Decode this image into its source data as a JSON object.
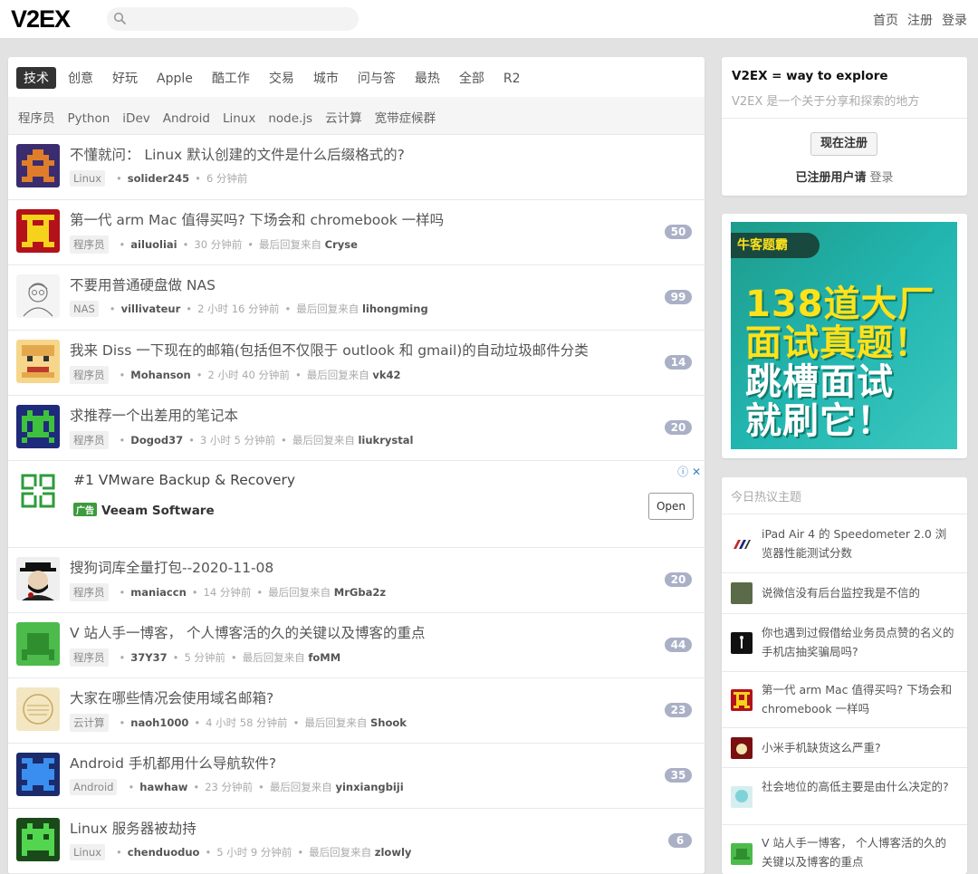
{
  "header": {
    "logo": "V2EX",
    "nav": [
      "首页",
      "注册",
      "登录"
    ]
  },
  "tabs": [
    "技术",
    "创意",
    "好玩",
    "Apple",
    "酷工作",
    "交易",
    "城市",
    "问与答",
    "最热",
    "全部",
    "R2"
  ],
  "subtabs": [
    "程序员",
    "Python",
    "iDev",
    "Android",
    "Linux",
    "node.js",
    "云计算",
    "宽带症候群"
  ],
  "topics": [
    {
      "title": "不懂就问： Linux 默认创建的文件是什么后缀格式的?",
      "node": "Linux",
      "user": "solider245",
      "time": "6 分钟前",
      "reply_label": "",
      "last_user": "",
      "count": ""
    },
    {
      "title": "第一代 arm Mac 值得买吗? 下场会和 chromebook 一样吗",
      "node": "程序员",
      "user": "ailuoliai",
      "time": "30 分钟前",
      "reply_label": "最后回复来自",
      "last_user": "Cryse",
      "count": "50"
    },
    {
      "title": "不要用普通硬盘做 NAS",
      "node": "NAS",
      "user": "villivateur",
      "time": "2 小时 16 分钟前",
      "reply_label": "最后回复来自",
      "last_user": "lihongming",
      "count": "99"
    },
    {
      "title": "我来 Diss 一下现在的邮箱(包括但不仅限于 outlook 和 gmail)的自动垃圾邮件分类",
      "node": "程序员",
      "user": "Mohanson",
      "time": "2 小时 40 分钟前",
      "reply_label": "最后回复来自",
      "last_user": "vk42",
      "count": "14"
    },
    {
      "title": "求推荐一个出差用的笔记本",
      "node": "程序员",
      "user": "Dogod37",
      "time": "3 小时 5 分钟前",
      "reply_label": "最后回复来自",
      "last_user": "liukrystal",
      "count": "20"
    },
    {
      "title": "搜狗词库全量打包--2020-11-08",
      "node": "程序员",
      "user": "maniaccn",
      "time": "14 分钟前",
      "reply_label": "最后回复来自",
      "last_user": "MrGba2z",
      "count": "20"
    },
    {
      "title": "V 站人手一博客， 个人博客活的久的关键以及博客的重点",
      "node": "程序员",
      "user": "37Y37",
      "time": "5 分钟前",
      "reply_label": "最后回复来自",
      "last_user": "foMM",
      "count": "44"
    },
    {
      "title": "大家在哪些情况会使用域名邮箱?",
      "node": "云计算",
      "user": "naoh1000",
      "time": "4 小时 58 分钟前",
      "reply_label": "最后回复来自",
      "last_user": "Shook",
      "count": "23"
    },
    {
      "title": "Android 手机都用什么导航软件?",
      "node": "Android",
      "user": "hawhaw",
      "time": "23 分钟前",
      "reply_label": "最后回复来自",
      "last_user": "yinxiangbiji",
      "count": "35"
    },
    {
      "title": "Linux 服务器被劫持",
      "node": "Linux",
      "user": "chenduoduo",
      "time": "5 小时 9 分钟前",
      "reply_label": "最后回复来自",
      "last_user": "zlowly",
      "count": "6"
    }
  ],
  "ad": {
    "title": "#1 VMware Backup & Recovery",
    "badge": "广告",
    "sponsor": "Veeam Software",
    "button": "Open"
  },
  "sidebar": {
    "title": "V2EX = way to explore",
    "subtitle": "V2EX 是一个关于分享和探索的地方",
    "register_button": "现在注册",
    "registered_text": "已注册用户请",
    "login_link": "登录"
  },
  "banner": {
    "tag": "牛客题霸",
    "line1": "138道大厂",
    "line2": "面试真题！",
    "line3": "跳槽面试",
    "line4": "就刷它！"
  },
  "hot": {
    "heading": "今日热议主题",
    "items": [
      "iPad Air 4 的 Speedometer 2.0 浏览器性能测试分数",
      "说微信没有后台监控我是不信的",
      "你也遇到过假借给业务员点赞的名义的手机店抽奖骗局吗?",
      "第一代 arm Mac 值得买吗? 下场会和 chromebook 一样吗",
      "小米手机缺货这么严重?",
      "社会地位的高低主要是由什么决定的?",
      "V 站人手一博客， 个人博客活的久的关键以及博客的重点"
    ]
  },
  "colors": {
    "accent_dark": "#333333",
    "count_badge": "#aab0c6",
    "ad_green": "#3d9a3d",
    "banner_yellow": "#ffe21a"
  }
}
